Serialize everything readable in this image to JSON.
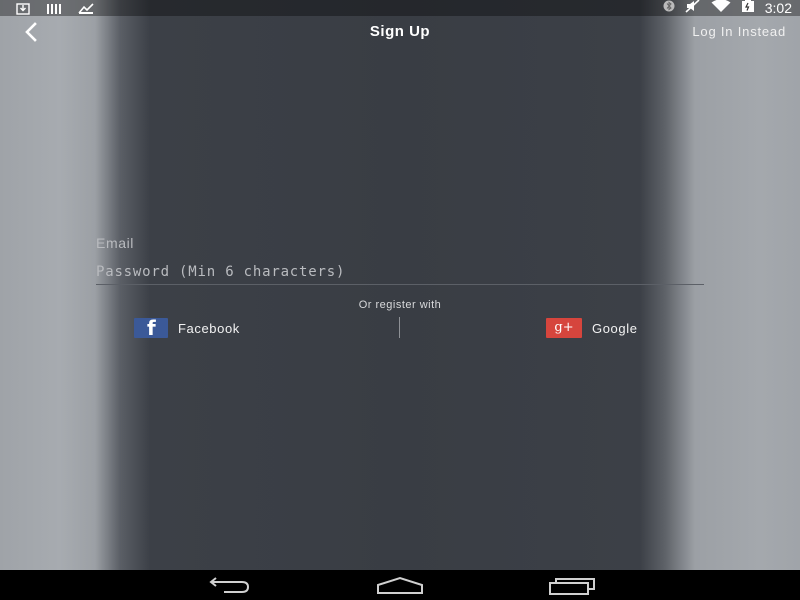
{
  "status_bar": {
    "time": "3:02",
    "left_icons": [
      "download-icon",
      "signal-bars-icon",
      "image-check-icon"
    ],
    "right_icons": [
      "bluetooth-icon",
      "mute-icon",
      "wifi-icon",
      "battery-icon"
    ]
  },
  "header": {
    "title": "Sign Up",
    "login_link": "Log In Instead",
    "back_icon": "chevron-left-icon"
  },
  "form": {
    "email_placeholder": "Email",
    "email_value": "",
    "password_placeholder": "Password (Min 6 characters)",
    "password_value": ""
  },
  "social": {
    "heading": "Or register with",
    "facebook_label": "Facebook",
    "facebook_icon_letter": "f",
    "google_label": "Google",
    "google_icon_text": "g+"
  },
  "nav_bar": {
    "icons": [
      "back-icon",
      "home-icon",
      "recents-icon"
    ]
  },
  "colors": {
    "facebook_blue": "#3b5998",
    "google_red": "#d6453d",
    "panel_dark": "#393d44"
  }
}
